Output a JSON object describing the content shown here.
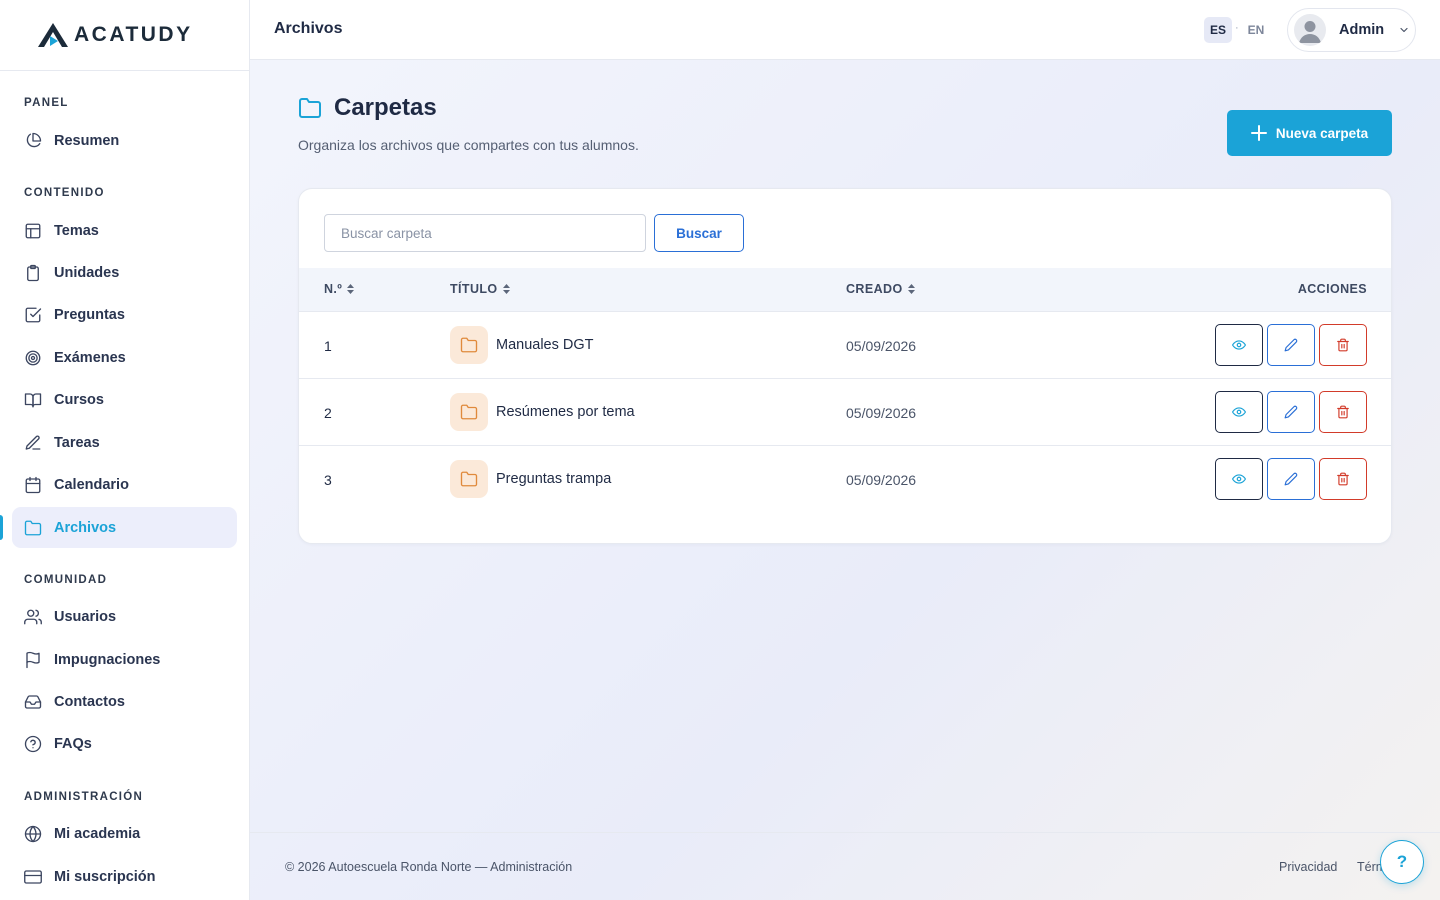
{
  "brand": {
    "name": "ACATUDY"
  },
  "sidebar": {
    "sections": [
      {
        "title": "PANEL"
      },
      {
        "title": "CONTENIDO"
      },
      {
        "title": "COMUNIDAD"
      },
      {
        "title": "ADMINISTRACIÓN"
      }
    ],
    "items": [
      {
        "label": "Resumen",
        "icon": "pie-chart-icon"
      },
      {
        "label": "Temas",
        "icon": "layout-icon"
      },
      {
        "label": "Unidades",
        "icon": "clipboard-icon"
      },
      {
        "label": "Preguntas",
        "icon": "check-square-icon"
      },
      {
        "label": "Exámenes",
        "icon": "target-icon"
      },
      {
        "label": "Cursos",
        "icon": "book-open-icon"
      },
      {
        "label": "Tareas",
        "icon": "pen-icon"
      },
      {
        "label": "Calendario",
        "icon": "calendar-icon"
      },
      {
        "label": "Archivos",
        "icon": "folder-icon",
        "active": true
      },
      {
        "label": "Usuarios",
        "icon": "users-icon"
      },
      {
        "label": "Impugnaciones",
        "icon": "flag-icon"
      },
      {
        "label": "Contactos",
        "icon": "inbox-icon"
      },
      {
        "label": "FAQs",
        "icon": "help-circle-icon"
      },
      {
        "label": "Mi academia",
        "icon": "globe-icon"
      },
      {
        "label": "Mi suscripción",
        "icon": "credit-card-icon"
      }
    ]
  },
  "topbar": {
    "title": "Archivos",
    "lang_active": "ES",
    "lang_separator": "·",
    "lang_other": "EN",
    "user_name": "Admin"
  },
  "page": {
    "title": "Carpetas",
    "subtitle": "Organiza los archivos que compartes con tus alumnos.",
    "new_button": "Nueva carpeta"
  },
  "search": {
    "placeholder": "Buscar carpeta",
    "value": "",
    "button": "Buscar"
  },
  "table": {
    "columns": [
      "N.º",
      "TÍTULO",
      "CREADO",
      "ACCIONES"
    ],
    "rows": [
      {
        "num": "1",
        "title": "Manuales DGT",
        "created": "05/09/2026"
      },
      {
        "num": "2",
        "title": "Resúmenes por tema",
        "created": "05/09/2026"
      },
      {
        "num": "3",
        "title": "Preguntas trampa",
        "created": "05/09/2026"
      }
    ]
  },
  "footer": {
    "copyright": "© 2026 Autoescuela Ronda Norte — Administración",
    "privacy": "Privacidad",
    "terms": "Térm"
  },
  "help": {
    "label": "?"
  },
  "colors": {
    "accent": "#1ba3d7",
    "edit": "#2a6fd6",
    "danger": "#d23b2a",
    "folder": "#e08a3c"
  }
}
